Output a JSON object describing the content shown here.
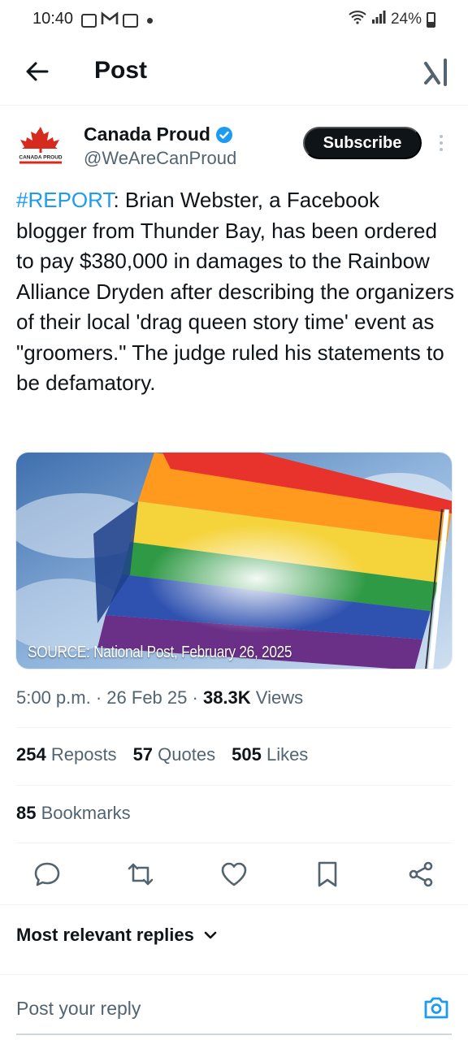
{
  "status_bar": {
    "time": "10:40",
    "battery": "24%"
  },
  "header": {
    "title": "Post"
  },
  "author": {
    "avatar_text": "CANADA PROUD",
    "name": "Canada Proud",
    "handle": "@WeAreCanProud",
    "subscribe_label": "Subscribe"
  },
  "tweet": {
    "hashtag": "#REPORT",
    "body": ": Brian Webster, a Facebook blogger from Thunder Bay, has been ordered to pay $380,000 in damages to the Rainbow Alliance Dryden after describing the organizers of their local 'drag queen story time' event as \"groomers.\" The judge ruled his statements to be defamatory."
  },
  "media": {
    "caption": "SOURCE: National Post, February 26, 2025"
  },
  "meta": {
    "time": "5:00 p.m.",
    "date": "26 Feb 25",
    "views_count": "38.3K",
    "views_label": "Views",
    "sep": "·"
  },
  "stats": {
    "reposts_count": "254",
    "reposts_label": "Reposts",
    "quotes_count": "57",
    "quotes_label": "Quotes",
    "likes_count": "505",
    "likes_label": "Likes",
    "bookmarks_count": "85",
    "bookmarks_label": "Bookmarks"
  },
  "replies": {
    "filter_label": "Most relevant replies",
    "placeholder": "Post your reply"
  },
  "colors": {
    "accent": "#1d9bf0",
    "text": "#0f1419",
    "secondary": "#536471",
    "divider": "#eff3f4"
  }
}
